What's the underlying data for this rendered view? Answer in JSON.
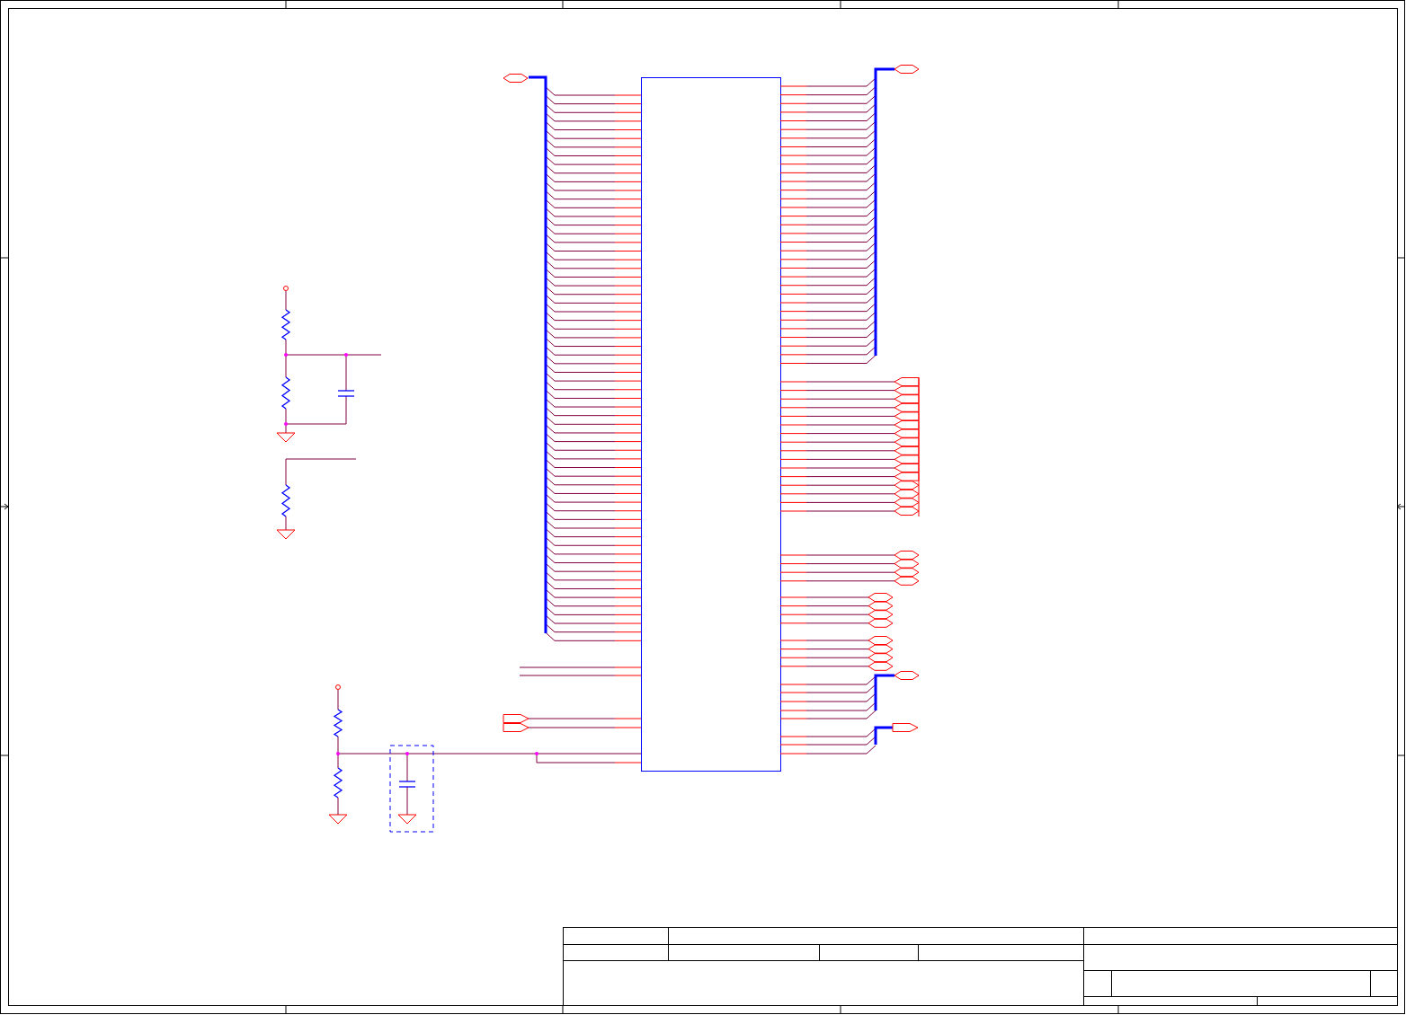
{
  "schematic": {
    "ports": [
      {
        "kind": "hexagon"
      },
      {
        "kind": "hexagon"
      },
      {
        "kind": "input"
      },
      {
        "kind": "input"
      },
      {
        "kind": "input"
      },
      {
        "kind": "input"
      },
      {
        "kind": "input"
      },
      {
        "kind": "input"
      },
      {
        "kind": "input"
      },
      {
        "kind": "input"
      },
      {
        "kind": "input"
      },
      {
        "kind": "input"
      },
      {
        "kind": "input"
      },
      {
        "kind": "input"
      },
      {
        "kind": "hexagon"
      },
      {
        "kind": "hexagon"
      },
      {
        "kind": "hexagon"
      },
      {
        "kind": "hexagon"
      },
      {
        "kind": "hexagon"
      },
      {
        "kind": "hexagon"
      },
      {
        "kind": "hexagon"
      },
      {
        "kind": "hexagon"
      },
      {
        "kind": "hexagon"
      },
      {
        "kind": "hexagon"
      },
      {
        "kind": "hexagon"
      },
      {
        "kind": "hexagon"
      },
      {
        "kind": "hexagon"
      },
      {
        "kind": "hexagon"
      },
      {
        "kind": "hexagon"
      },
      {
        "kind": "hexagon"
      },
      {
        "kind": "hexagon"
      },
      {
        "kind": "output"
      },
      {
        "kind": "output"
      },
      {
        "kind": "output"
      }
    ]
  }
}
